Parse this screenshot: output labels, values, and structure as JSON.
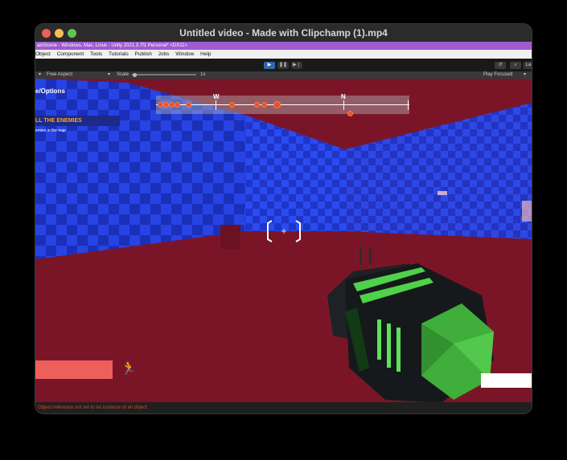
{
  "window": {
    "title": "Untitled video - Made with Clipchamp (1).mp4"
  },
  "unity_bar": {
    "text": "ainScene - Windows, Mac, Linux - Unity 2021.3.7f1 Personal* <DX11>"
  },
  "menu": {
    "items": [
      "Object",
      "Component",
      "Tools",
      "Tutorials",
      "Publish",
      "Jobs",
      "Window",
      "Help"
    ]
  },
  "toolbar": {
    "play_icon": "play-icon",
    "pause_icon": "pause-icon",
    "step_icon": "step-icon",
    "right_label": "La"
  },
  "game_view": {
    "aspect": "Free Aspect",
    "scale_label": "Scale",
    "scale_value": "1x",
    "play_mode": "Play Focused"
  },
  "hud": {
    "options_label": "e/Options",
    "objective_title": "LL THE ENEMIES",
    "objective_desc": "emies in the map",
    "compass_w": "W",
    "compass_n": "N",
    "health_fraction": 0.8
  },
  "console": {
    "message": "Object reference not set to an instance of an object"
  },
  "colors": {
    "unity_accent": "#a05bcf",
    "floor": "#7a1528",
    "wall_blue": "#1f35c8",
    "health": "#ec5f5a",
    "objective_text": "#f5a623",
    "gun_green": "#3fae3a"
  }
}
